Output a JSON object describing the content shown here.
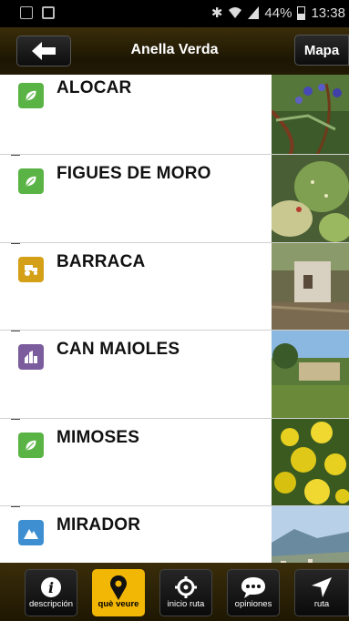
{
  "status_bar": {
    "battery": "44%",
    "time": "13:38",
    "battery_level": 0.44
  },
  "header": {
    "title": "Anella Verda",
    "map_label": "Mapa"
  },
  "items": [
    {
      "name": "ALOCAR",
      "icon": "leaf-icon",
      "color": "#5ab345"
    },
    {
      "name": "FIGUES DE MORO",
      "icon": "leaf-icon",
      "color": "#5ab345"
    },
    {
      "name": "BARRACA",
      "icon": "tractor-icon",
      "color": "#d4a017"
    },
    {
      "name": "CAN MAIOLES",
      "icon": "building-icon",
      "color": "#7b5c9c"
    },
    {
      "name": "MIMOSES",
      "icon": "leaf-icon",
      "color": "#5ab345"
    },
    {
      "name": "MIRADOR",
      "icon": "mountain-icon",
      "color": "#3d8fd1"
    }
  ],
  "tabs": [
    {
      "label": "descripción",
      "icon": "info-icon"
    },
    {
      "label": "què veure",
      "icon": "map-pin-icon"
    },
    {
      "label": "inicio ruta",
      "icon": "crosshair-icon"
    },
    {
      "label": "opiniones",
      "icon": "chat-icon"
    },
    {
      "label": "ruta",
      "icon": "navigation-arrow-icon"
    }
  ],
  "colors": {
    "accent": "#f2b705",
    "header_bg": "#2a2005"
  }
}
